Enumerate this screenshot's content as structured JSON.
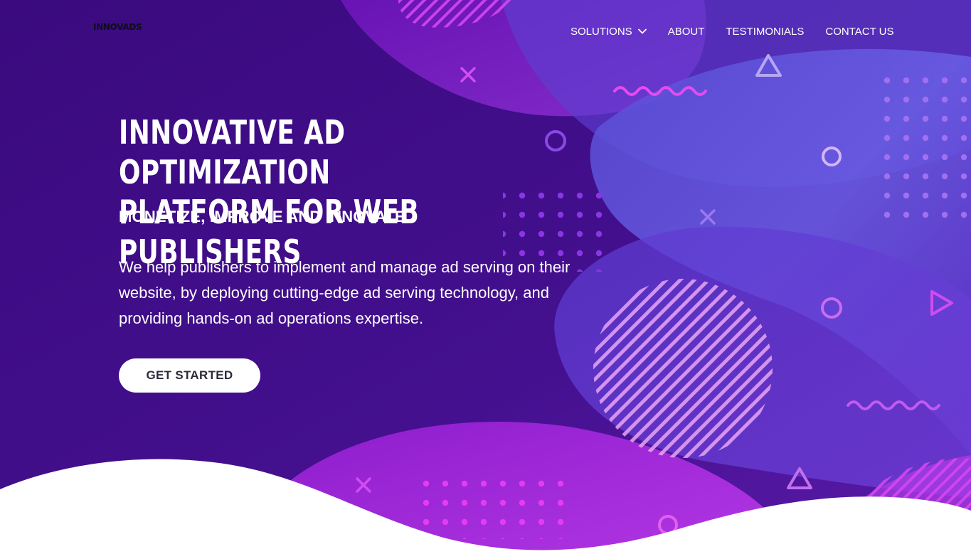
{
  "header": {
    "logo_text": "INNOVADS",
    "nav": [
      {
        "label": "SOLUTIONS",
        "has_dropdown": true
      },
      {
        "label": "ABOUT"
      },
      {
        "label": "TESTIMONIALS"
      },
      {
        "label": "CONTACT US"
      }
    ]
  },
  "hero": {
    "title_line1": "INNOVATIVE AD OPTIMIZATION",
    "title_line2": "PLATFORM FOR WEB PUBLISHERS",
    "subtitle": "MONETIZE, IMPROVE AND INNOVATE",
    "description": "We help publishers to implement and manage ad serving on their website, by deploying cutting-edge ad serving technology, and providing hands-on ad operations expertise.",
    "cta_label": "GET STARTED"
  },
  "colors": {
    "background": "#3c0a86",
    "accent_pink": "#e44bf0",
    "accent_violet": "#7a63ee",
    "button_bg": "#ffffff",
    "button_text": "#2b2b3a"
  }
}
